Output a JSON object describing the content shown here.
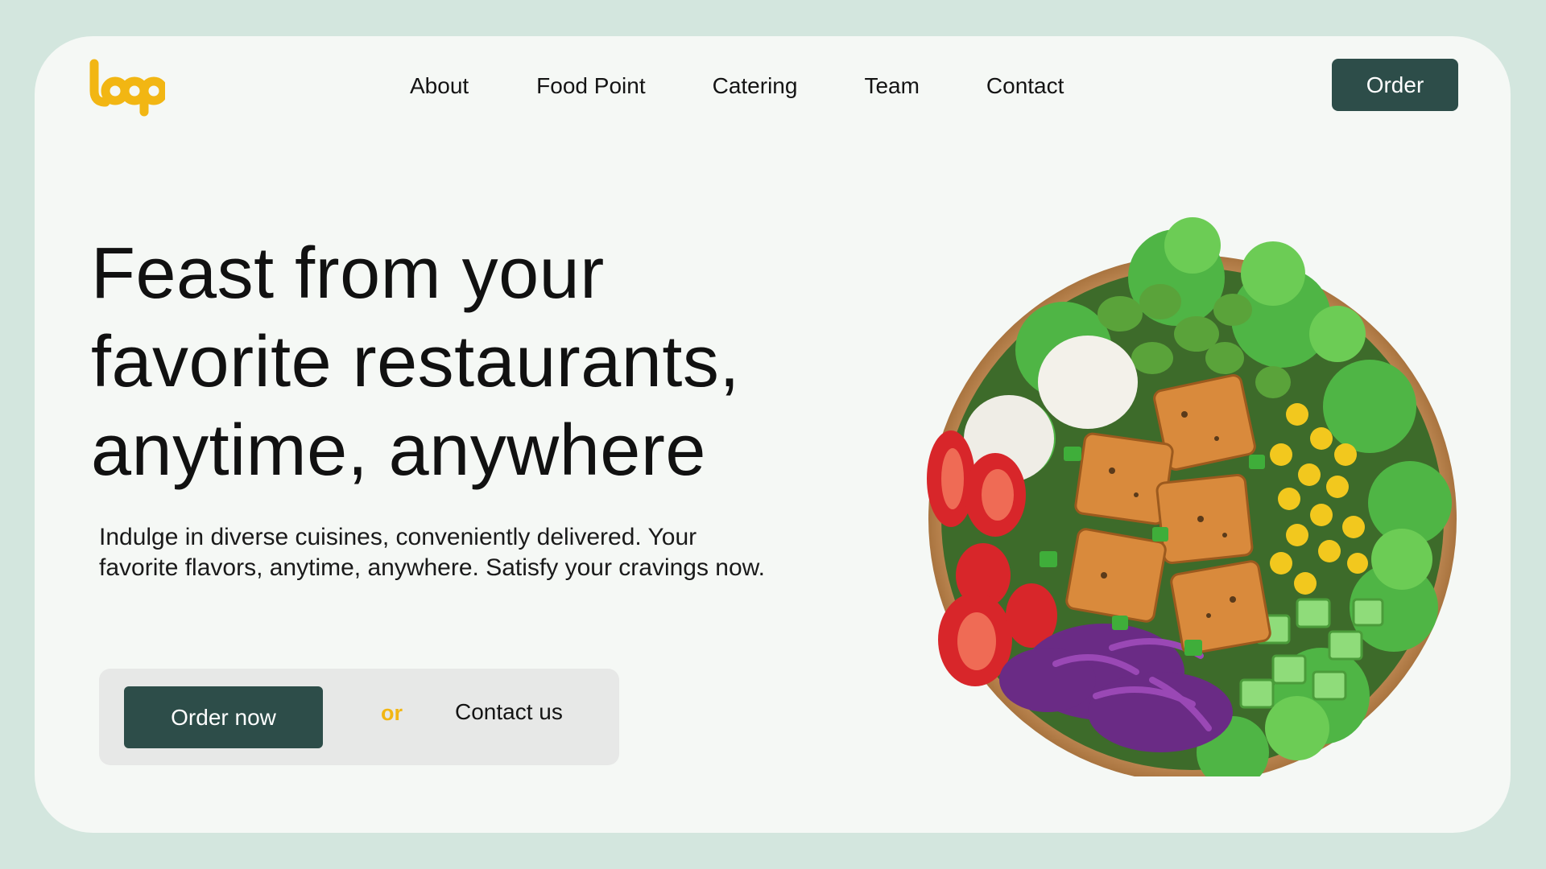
{
  "brand": {
    "logo_text": "loop",
    "logo_color": "#f2b613"
  },
  "nav": {
    "items": [
      {
        "label": "About"
      },
      {
        "label": "Food Point"
      },
      {
        "label": "Catering"
      },
      {
        "label": "Team"
      },
      {
        "label": "Contact"
      }
    ],
    "order_label": "Order"
  },
  "hero": {
    "title_lines": [
      "Feast from your",
      "favorite restaurants,",
      "anytime, anywhere"
    ],
    "subtitle_lines": [
      "Indulge in diverse cuisines, conveniently delivered. Your",
      "favorite flavors, anytime, anywhere. Satisfy your cravings now."
    ],
    "cta_primary": "Order now",
    "cta_or": "or",
    "cta_secondary": "Contact us",
    "image": "salad-bowl"
  },
  "colors": {
    "background": "#d3e6de",
    "card": "#f5f8f5",
    "accent": "#2d4d49",
    "brand_yellow": "#f2b613"
  }
}
